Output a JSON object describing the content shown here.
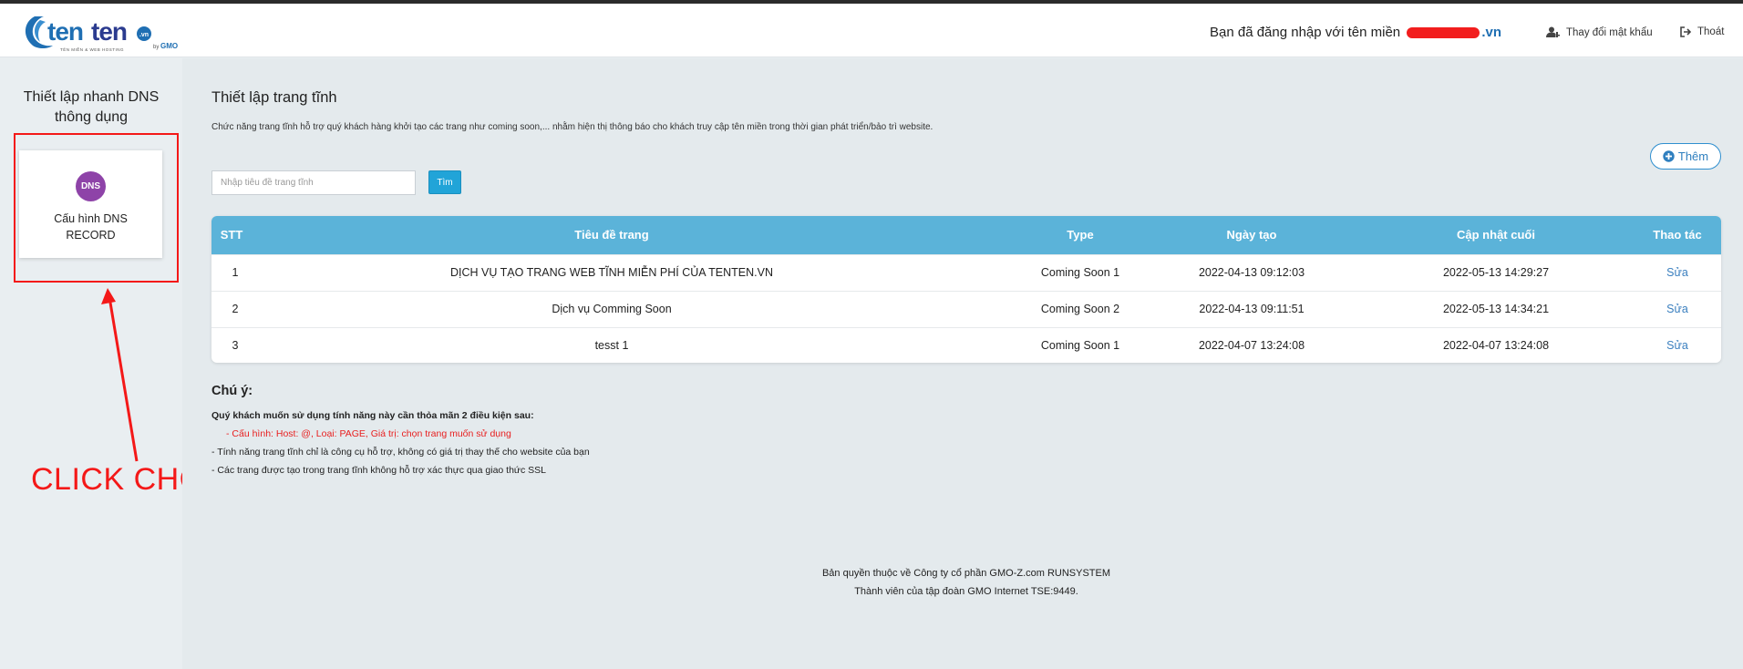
{
  "header": {
    "logo_alt": "tenten.vn by GMO",
    "login_prefix": "Bạn đã đăng nhập với tên miền",
    "login_suffix": ".vn",
    "change_password": "Thay đổi mật khẩu",
    "logout": "Thoát"
  },
  "sidebar": {
    "title_line1": "Thiết lập nhanh DNS",
    "title_line2": "thông dụng",
    "card": {
      "badge": "DNS",
      "label_line1": "Cấu hình DNS",
      "label_line2": "RECORD"
    },
    "annotation": "CLICK CHỌN"
  },
  "main": {
    "title": "Thiết lập trang tĩnh",
    "description": "Chức năng trang tĩnh hỗ trợ quý khách hàng khởi tạo các trang như coming soon,... nhằm hiện thị thông báo cho khách truy cập tên miền trong thời gian phát triển/bảo trì website.",
    "add_button": "Thêm",
    "search": {
      "placeholder": "Nhập tiêu đề trang tĩnh",
      "button": "Tìm"
    },
    "table": {
      "headers": {
        "stt": "STT",
        "title": "Tiêu đề trang",
        "type": "Type",
        "created": "Ngày tạo",
        "updated": "Cập nhật cuối",
        "action": "Thao tác"
      },
      "rows": [
        {
          "stt": "1",
          "title": "DỊCH VỤ TẠO TRANG WEB TĨNH MIỄN PHÍ CỦA TENTEN.VN",
          "type": "Coming Soon 1",
          "created": "2022-04-13 09:12:03",
          "updated": "2022-05-13 14:29:27",
          "action": "Sửa"
        },
        {
          "stt": "2",
          "title": "Dịch vụ Comming Soon",
          "type": "Coming Soon 2",
          "created": "2022-04-13 09:11:51",
          "updated": "2022-05-13 14:34:21",
          "action": "Sửa"
        },
        {
          "stt": "3",
          "title": "tesst 1",
          "type": "Coming Soon 1",
          "created": "2022-04-07 13:24:08",
          "updated": "2022-04-07 13:24:08",
          "action": "Sửa"
        }
      ]
    },
    "notes": {
      "title": "Chú ý:",
      "heading": "Quý khách muốn sử dụng tính năng này cần thỏa mãn 2 điều kiện sau:",
      "red_line": "- Cấu hình: Host: @, Loại: PAGE, Giá trị: chọn trang muốn sử dụng",
      "line2": "- Tính năng trang tĩnh chỉ là công cụ hỗ trợ, không có giá trị thay thế cho website của bạn",
      "line3": "- Các trang được tạo trong trang tĩnh không hỗ trợ xác thực qua giao thức SSL"
    },
    "footer": {
      "line1": "Bản quyền thuộc về Công ty cổ phần GMO-Z.com RUNSYSTEM",
      "line2": "Thành viên của tập đoàn GMO Internet TSE:9449."
    }
  },
  "colors": {
    "accent": "#21a4d8",
    "table_header": "#5bb3d9",
    "annotation_red": "#f41818",
    "dns_badge": "#8e43a8"
  }
}
